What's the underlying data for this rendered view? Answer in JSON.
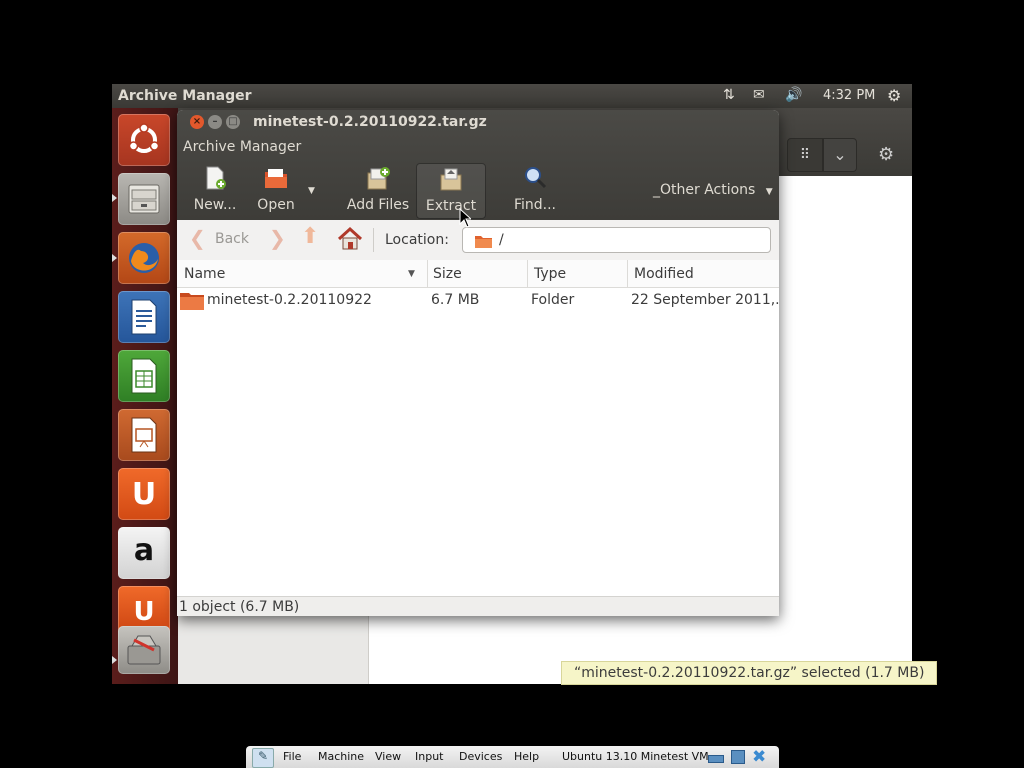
{
  "top_panel": {
    "title": "Archive Manager",
    "clock": "4:32 PM",
    "indicators": [
      "network-icon",
      "mail-icon",
      "volume-icon",
      "settings-gear-icon"
    ]
  },
  "launcher": {
    "items": [
      {
        "name": "dash-home",
        "icon": "ubuntu-logo-icon"
      },
      {
        "name": "files",
        "icon": "file-cabinet-icon"
      },
      {
        "name": "firefox",
        "icon": "firefox-icon"
      },
      {
        "name": "libreoffice-writer",
        "icon": "writer-icon"
      },
      {
        "name": "libreoffice-calc",
        "icon": "calc-icon"
      },
      {
        "name": "libreoffice-impress",
        "icon": "impress-icon"
      },
      {
        "name": "ubuntu-software-center",
        "icon": "software-center-icon"
      },
      {
        "name": "amazon",
        "icon": "amazon-icon"
      },
      {
        "name": "ubuntu-one",
        "icon": "ubuntu-one-icon"
      },
      {
        "name": "archive",
        "icon": "archive-icon"
      }
    ],
    "amazon_letter": "a",
    "software_letter": "U"
  },
  "archive_manager": {
    "window_title": "minetest-0.2.20110922.tar.gz",
    "app_name": "Archive Manager",
    "toolbar": {
      "new_label": "New...",
      "open_label": "Open",
      "add_files_label": "Add Files",
      "extract_label": "Extract",
      "find_label": "Find...",
      "other_actions_label": "_Other Actions"
    },
    "location": {
      "back_label": "Back",
      "label": "Location:",
      "value": "/"
    },
    "columns": [
      "Name",
      "Size",
      "Type",
      "Modified"
    ],
    "rows": [
      {
        "name": "minetest-0.2.20110922",
        "size": "6.7 MB",
        "type": "Folder",
        "modified": "22 September 2011,..."
      }
    ],
    "status": "1 object (6.7 MB)"
  },
  "background_window": {
    "status_message": "“minetest-0.2.20110922.tar.gz” selected  (1.7 MB)"
  },
  "vbox_bar": {
    "menus": [
      "File",
      "Machine",
      "View",
      "Input",
      "Devices",
      "Help"
    ],
    "vm_name": "Ubuntu 13.10 Minetest VM"
  },
  "colors": {
    "panel_dark": "#3c3b37",
    "launcher": "#4a1a18",
    "ubuntu_orange": "#dd4814",
    "close_button": "#e2582c"
  }
}
